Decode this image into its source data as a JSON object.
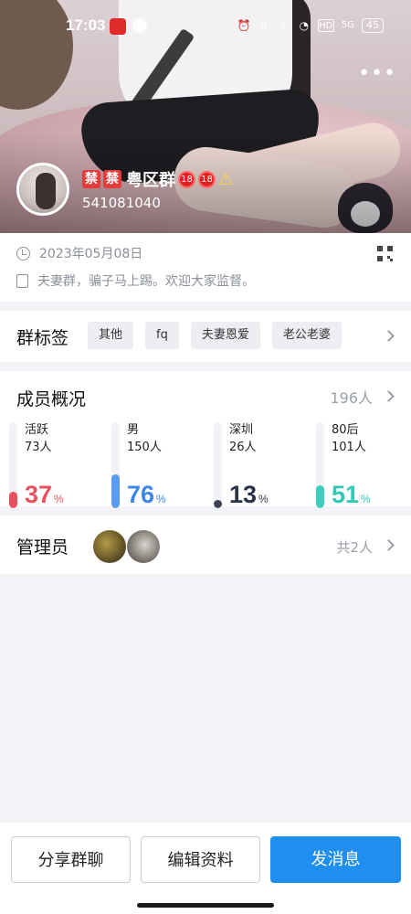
{
  "status_bar": {
    "time": "17:03",
    "network_label": "5G",
    "battery": "45"
  },
  "header": {
    "more_icon": "more-dots-icon",
    "group_name_tags": [
      "禁",
      "禁"
    ],
    "group_name": "粤区群",
    "age_badge": "18",
    "group_id": "541081040"
  },
  "info": {
    "created_date": "2023年05月08日",
    "description": "夫妻群，骗子马上踢。欢迎大家监督。"
  },
  "tags": {
    "title": "群标签",
    "items": [
      "其他",
      "fq",
      "夫妻恩爱",
      "老公老婆"
    ]
  },
  "members": {
    "title": "成员概况",
    "count": "196人",
    "stats": [
      {
        "label": "活跃",
        "count": "73人",
        "percent": "37",
        "unit": "%",
        "fill": 0.37,
        "color": "#e8505e",
        "fill_color": "#e8505e"
      },
      {
        "label": "男",
        "count": "150人",
        "percent": "76",
        "unit": "%",
        "fill": 0.76,
        "color": "#3d86e8",
        "fill_color": "#5b9bf0"
      },
      {
        "label": "深圳",
        "count": "26人",
        "percent": "13",
        "unit": "%",
        "fill": 0.13,
        "color": "#2a3348",
        "fill_color": "#3a4254"
      },
      {
        "label": "80后",
        "count": "101人",
        "percent": "51",
        "unit": "%",
        "fill": 0.51,
        "color": "#2fc9b8",
        "fill_color": "#3ccdbd"
      }
    ]
  },
  "admins": {
    "title": "管理员",
    "count": "共2人"
  },
  "actions": {
    "share": "分享群聊",
    "edit": "编辑资料",
    "message": "发消息"
  }
}
